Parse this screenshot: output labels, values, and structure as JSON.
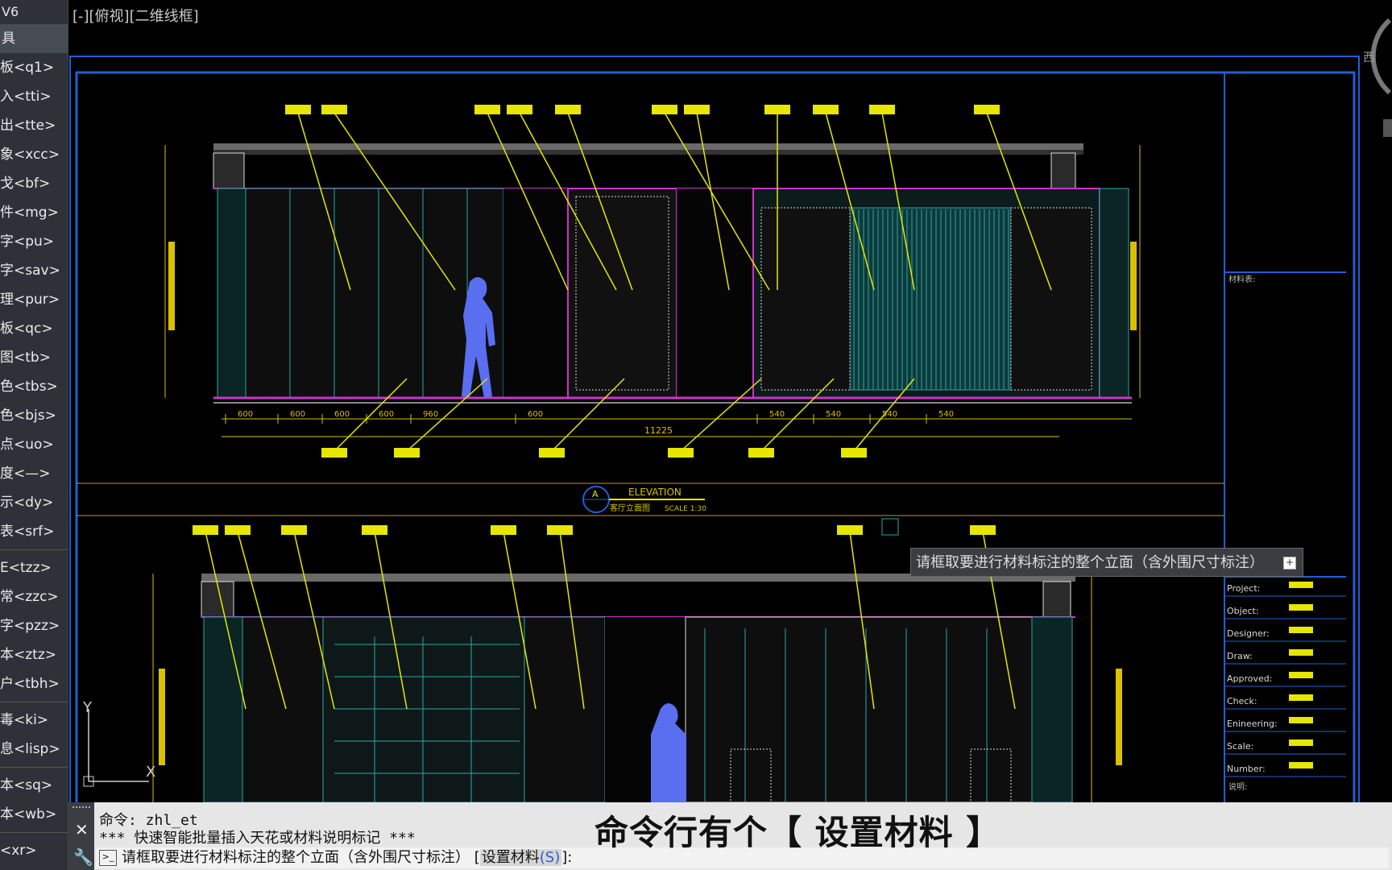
{
  "app": {
    "version_label": "V6"
  },
  "palette": {
    "header": "具",
    "items": [
      "板<q1>",
      "入<tti>",
      "出<tte>",
      "象<xcc>",
      "戈<bf>",
      "件<mg>",
      "字<pu>",
      "字<sav>",
      "理<pur>",
      "板<qc>",
      "图<tb>",
      "色<tbs>",
      "色<bjs>",
      "点<uo>",
      "度<—>",
      "示<dy>",
      "表<srf>",
      "E<tzz>",
      "常<zzc>",
      "字<pzz>",
      "本<ztz>",
      "户<tbh>",
      "毒<ki>",
      "息<lisp>",
      "本<sq>",
      "本<wb>",
      "<xr>"
    ]
  },
  "viewport": {
    "label": "[-][俯视][二维线框]",
    "viewcube_face": "西"
  },
  "drawing": {
    "elevation_title": "ELEVATION",
    "elevation_subtitle": "客厅立面图",
    "scale": "SCALE 1:30",
    "top_dims": [
      "600",
      "600",
      "600",
      "600",
      "960",
      "600",
      "540",
      "540",
      "540",
      "540"
    ],
    "top_total": "11225",
    "titleblock": {
      "material_table": "材料表:",
      "rows": [
        "Project:",
        "Object:",
        "Designer:",
        "Draw:",
        "Approved:",
        "Check:",
        "Enineering:",
        "Scale:",
        "Number:"
      ],
      "note": "说明:"
    },
    "ucs_x": "X",
    "ucs_y": "Y"
  },
  "tooltip": {
    "text": "请框取要进行材料标注的整个立面（含外围尺寸标注）"
  },
  "command": {
    "history_1": "命令: zhl_et",
    "history_2": "*** 快速智能批量插入天花或材料说明标记 ***",
    "prompt": "请框取要进行材料标注的整个立面（含外围尺寸标注）",
    "option_text": "设置材料",
    "option_key": "(S)",
    "suffix": "]:"
  },
  "subtitle": "命令行有个【 设置材料 】",
  "colors": {
    "frame": "#1f5fd6",
    "dim": "#d9c000",
    "leader": "#e6e600",
    "magenta": "#cc33cc",
    "cyan": "#2aa7a7",
    "figure": "#5a6ef0"
  }
}
